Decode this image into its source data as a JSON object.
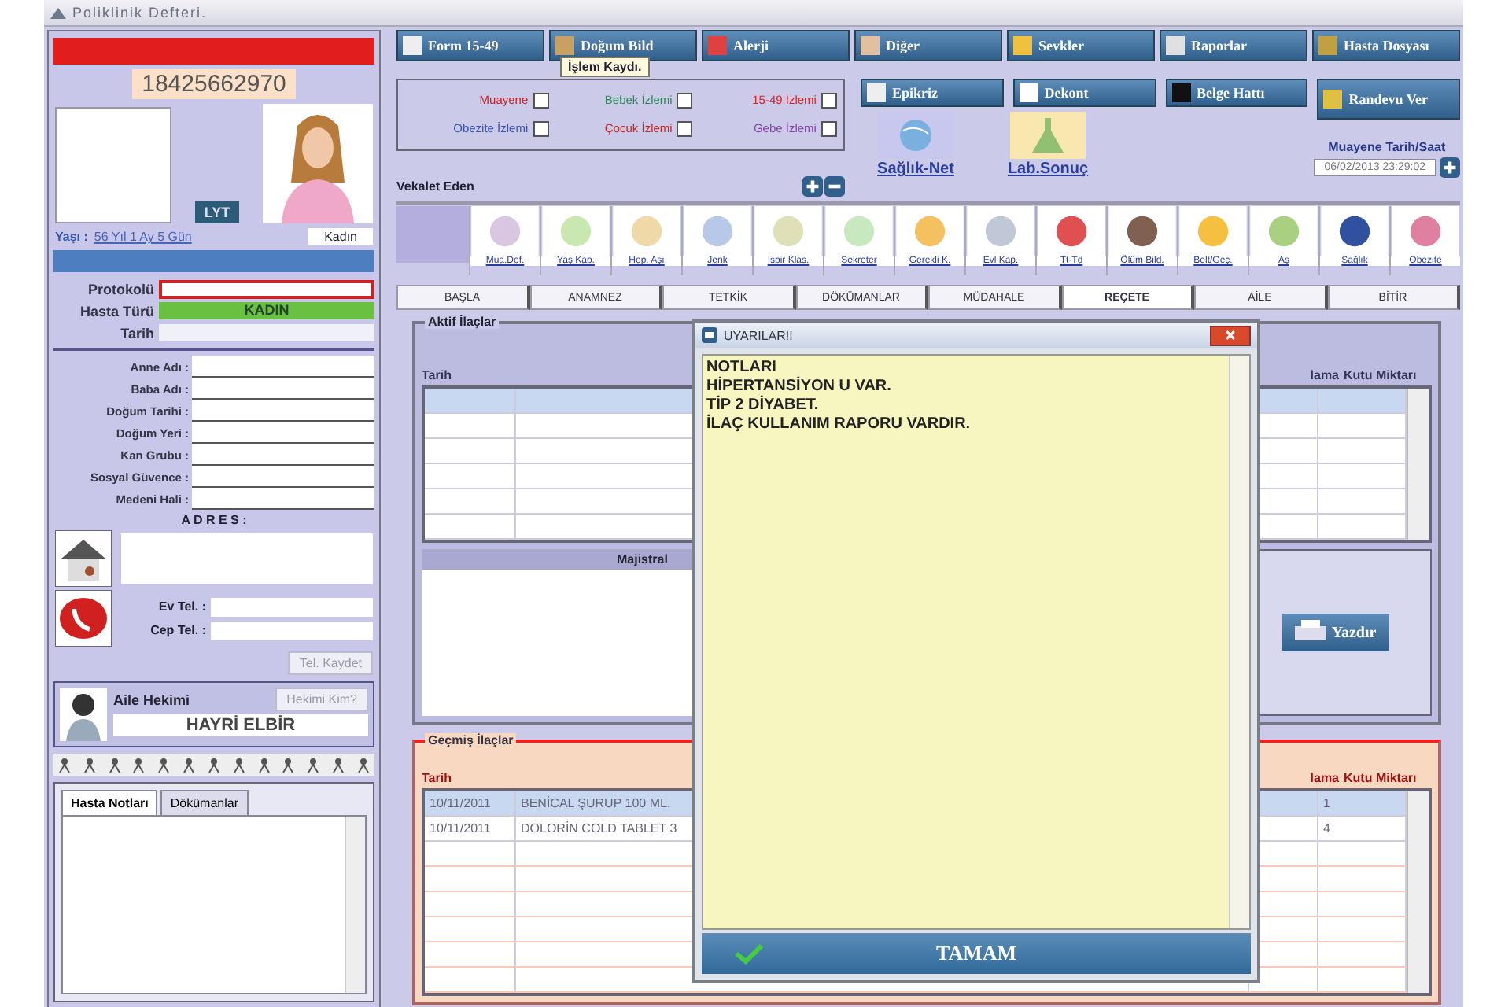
{
  "window": {
    "title": "Poliklinik Defteri."
  },
  "patient": {
    "tc_no": "18425662970",
    "photo_button": "LYT",
    "age_label": "Yaşı :",
    "age": "56 Yıl 1 Ay 5 Gün",
    "gender": "Kadın"
  },
  "visit_fields": [
    {
      "label": "Protokolü",
      "kind": "required"
    },
    {
      "label": "Hasta Türü",
      "value": "KADIN",
      "kind": "status"
    },
    {
      "label": "Tarih",
      "kind": "date"
    }
  ],
  "personal_fields": [
    {
      "label": "Anne Adı :"
    },
    {
      "label": "Baba Adı :"
    },
    {
      "label": "Doğum Tarihi :"
    },
    {
      "label": "Doğum Yeri :"
    },
    {
      "label": "Kan Grubu :"
    },
    {
      "label": "Sosyal Güvence :"
    },
    {
      "label": "Medeni Hali :"
    }
  ],
  "address": {
    "label": "A D R E S :"
  },
  "phones": [
    {
      "label": "Ev Tel. :"
    },
    {
      "label": "Cep Tel. :"
    }
  ],
  "save_phone_button": "Tel. Kaydet",
  "family_doctor": {
    "label": "Aile Hekimi",
    "button": "Hekimi Kim?",
    "name": "HAYRİ ELBİR"
  },
  "notes_tabs": [
    {
      "label": "Hasta Notları",
      "selected": true
    },
    {
      "label": "Dökümanlar",
      "selected": false
    }
  ],
  "top_buttons": [
    "Form 15-49",
    "Doğum Bild",
    "Alerji",
    "Diğer",
    "Sevkler",
    "Raporlar",
    "Hasta Dosyası"
  ],
  "tooltip": "İşlem Kaydı.",
  "visit_types": [
    {
      "label": "Muayene",
      "checked": false,
      "color": "#cc2222"
    },
    {
      "label": "Bebek İzlemi",
      "checked": false,
      "color": "#2e8b57"
    },
    {
      "label": "15-49 İzlemi",
      "checked": false,
      "color": "#dd2222"
    },
    {
      "label": "Obezite İzlemi",
      "checked": false,
      "color": "#3355bb"
    },
    {
      "label": "Çocuk İzlemi",
      "checked": false,
      "color": "#cc2222"
    },
    {
      "label": "Gebe İzlemi",
      "checked": false,
      "color": "#8844aa"
    }
  ],
  "action_buttons": [
    "Epikriz",
    "Dekont",
    "Belge Hattı",
    "Randevu Ver"
  ],
  "links": [
    "Sağlık-Net",
    "Lab.Sonuç"
  ],
  "proxy_label": "Vekalet Eden",
  "exam_datetime": {
    "label": "Muayene Tarih/Saat",
    "value": "06/02/2013 23:29:02"
  },
  "tools": [
    {
      "label": "Mua.Def."
    },
    {
      "label": "Yaş Kap."
    },
    {
      "label": "Hep. Aşı"
    },
    {
      "label": "Jenk"
    },
    {
      "label": "İspir Klas."
    },
    {
      "label": "Sekreter"
    },
    {
      "label": "Gerekli K."
    },
    {
      "label": "Evl Kap."
    },
    {
      "label": "Tt-Td"
    },
    {
      "label": "Ölüm Bild."
    },
    {
      "label": "Belt/Geç."
    },
    {
      "label": "Aş"
    },
    {
      "label": "Sağlık"
    },
    {
      "label": "Obezite"
    }
  ],
  "tabs": [
    {
      "label": "BAŞLA",
      "selected": false
    },
    {
      "label": "ANAMNEZ",
      "selected": false
    },
    {
      "label": "TETKİK",
      "selected": false
    },
    {
      "label": "DÖKÜMANLAR",
      "selected": false
    },
    {
      "label": "MÜDAHALE",
      "selected": false
    },
    {
      "label": "REÇETE",
      "selected": true
    },
    {
      "label": "AİLE",
      "selected": false
    },
    {
      "label": "BİTİR",
      "selected": false
    }
  ],
  "active_drugs": {
    "title": "Aktif İlaçlar",
    "columns": [
      "Tarih",
      "lama",
      "Kutu Miktarı"
    ],
    "magistral_label": "Majistral",
    "print_button": "Yazdır"
  },
  "past_drugs": {
    "title": "Geçmiş İlaçlar",
    "columns": [
      "Tarih",
      "lama",
      "Kutu Miktarı"
    ],
    "rows": [
      {
        "date": "10/11/2011",
        "name": "BENİCAL ŞURUP 100 ML.",
        "boxes": "1",
        "selected": true
      },
      {
        "date": "10/11/2011",
        "name": "DOLORİN COLD TABLET 3",
        "boxes": "4",
        "selected": false
      }
    ]
  },
  "dialog": {
    "title": "UYARILAR!!",
    "notes": [
      "NOTLARI",
      "HİPERTANSİYON U VAR.",
      "TİP 2 DİYABET.",
      "İLAÇ KULLANIM RAPORU VARDIR."
    ],
    "ok_button": "TAMAM"
  }
}
